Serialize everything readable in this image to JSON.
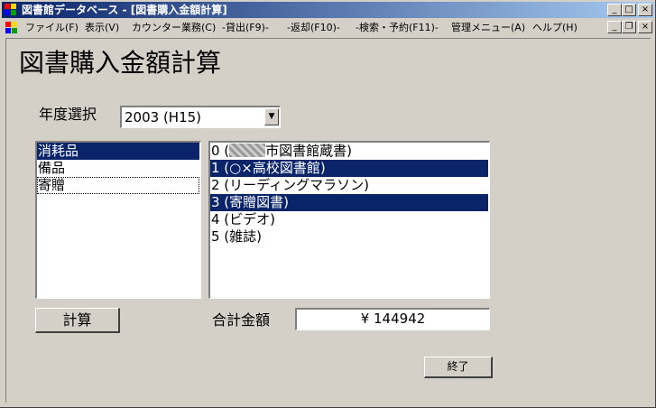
{
  "window": {
    "title": "図書館データベース - [図書購入金額計算]",
    "controls": {
      "minimize": "_",
      "maximize": "□",
      "close": "×"
    }
  },
  "menubar": {
    "items": [
      "ファイル(F)",
      "表示(V)",
      "カウンター業務(C)",
      "-貸出(F9)-",
      "-返却(F10)-",
      "-検索・予約(F11)-",
      "管理メニュー(A)",
      "ヘルプ(H)"
    ],
    "mdi_controls": {
      "minimize": "_",
      "restore": "❐",
      "close": "×"
    }
  },
  "form": {
    "title": "図書購入金額計算",
    "year_label": "年度選択",
    "year_selected": "2003 (H15)",
    "category_list": [
      {
        "label": "消耗品",
        "selected": true
      },
      {
        "label": "備品",
        "selected": false
      },
      {
        "label": "寄贈",
        "selected": false,
        "focused": true
      }
    ],
    "library_list": [
      {
        "label": "0 (",
        "label_suffix": "市図書館蔵書)",
        "redacted": true,
        "selected": false
      },
      {
        "label": "1 (○×高校図書館)",
        "selected": true
      },
      {
        "label": "2 (リーディングマラソン)",
        "selected": false
      },
      {
        "label": "3 (寄贈図書)",
        "selected": true
      },
      {
        "label": "4 (ビデオ)",
        "selected": false
      },
      {
        "label": "5 (雑誌)",
        "selected": false
      }
    ],
    "calc_button": "計算",
    "total_label": "合計金額",
    "total_value": "¥ 144942",
    "exit_button": "終了"
  }
}
